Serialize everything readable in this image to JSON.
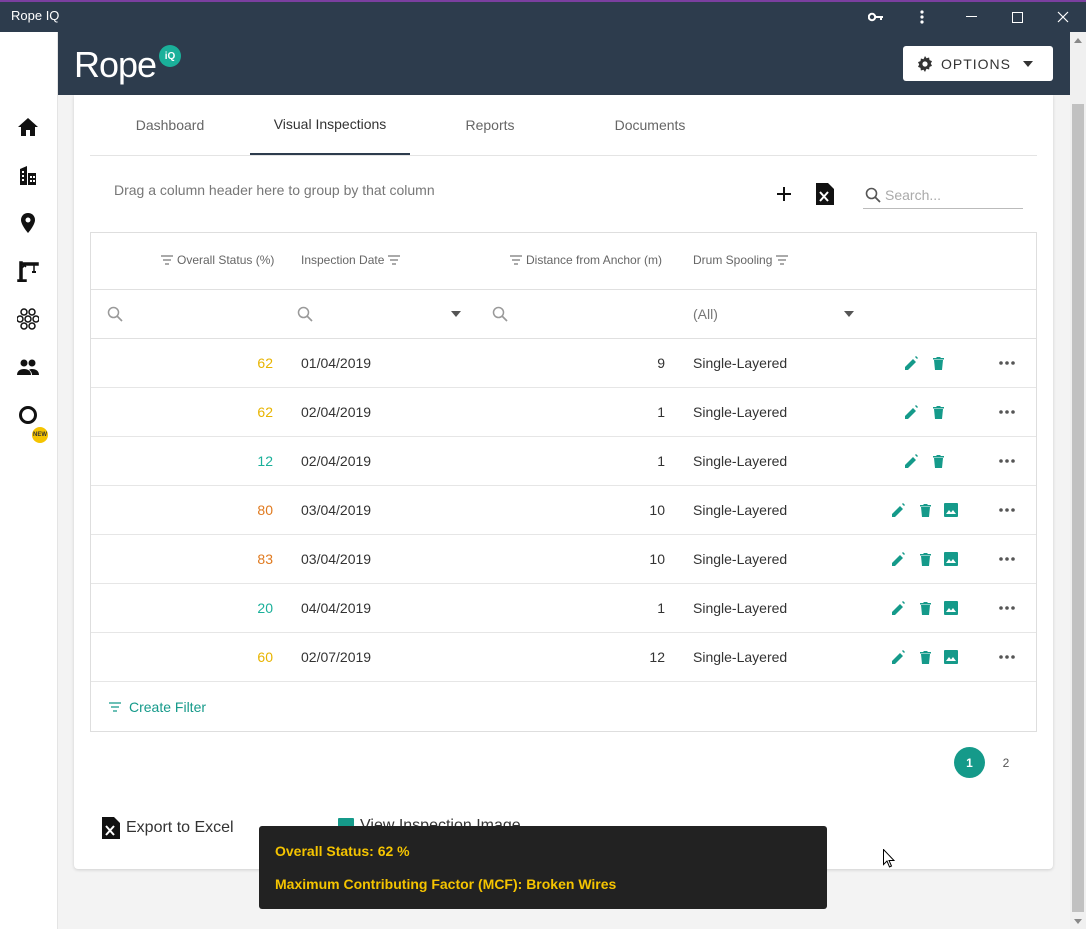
{
  "window": {
    "title": "Rope IQ"
  },
  "header": {
    "logo_text": "Rope",
    "logo_badge": "iQ",
    "options_label": "OPTIONS"
  },
  "nav": {
    "new_badge": "NEW"
  },
  "tabs": [
    {
      "label": "Dashboard"
    },
    {
      "label": "Visual Inspections"
    },
    {
      "label": "Reports"
    },
    {
      "label": "Documents"
    }
  ],
  "toolbar": {
    "group_hint": "Drag a column header here to group by that column",
    "search_placeholder": "Search..."
  },
  "grid": {
    "columns": [
      "Overall Status (%)",
      "Inspection Date",
      "Distance from Anchor (m)",
      "Drum Spooling"
    ],
    "filter_drum_value": "(All)",
    "rows": [
      {
        "status": "62",
        "date": "01/04/2019",
        "distance": "9",
        "drum": "Single-Layered"
      },
      {
        "status": "62",
        "date": "02/04/2019",
        "distance": "1",
        "drum": "Single-Layered"
      },
      {
        "status": "12",
        "date": "02/04/2019",
        "distance": "1",
        "drum": "Single-Layered"
      },
      {
        "status": "80",
        "date": "03/04/2019",
        "distance": "10",
        "drum": "Single-Layered"
      },
      {
        "status": "83",
        "date": "03/04/2019",
        "distance": "10",
        "drum": "Single-Layered"
      },
      {
        "status": "20",
        "date": "04/04/2019",
        "distance": "1",
        "drum": "Single-Layered"
      },
      {
        "status": "60",
        "date": "02/07/2019",
        "distance": "12",
        "drum": "Single-Layered"
      }
    ],
    "create_filter_label": "Create Filter"
  },
  "pager": {
    "pages": [
      "1",
      "2"
    ],
    "current": "1"
  },
  "actions": {
    "export_excel": "Export to Excel",
    "view_image": "View Inspection Image"
  },
  "tooltip": {
    "line1": "Overall Status: 62 %",
    "line2": "Maximum Contributing Factor (MCF): Broken Wires"
  },
  "colors": {
    "teal": "#159a8a",
    "status_yellow": "#e8b400",
    "status_orange": "#e07a1f",
    "status_green": "#1ab09a",
    "header": "#2d3c4d"
  }
}
